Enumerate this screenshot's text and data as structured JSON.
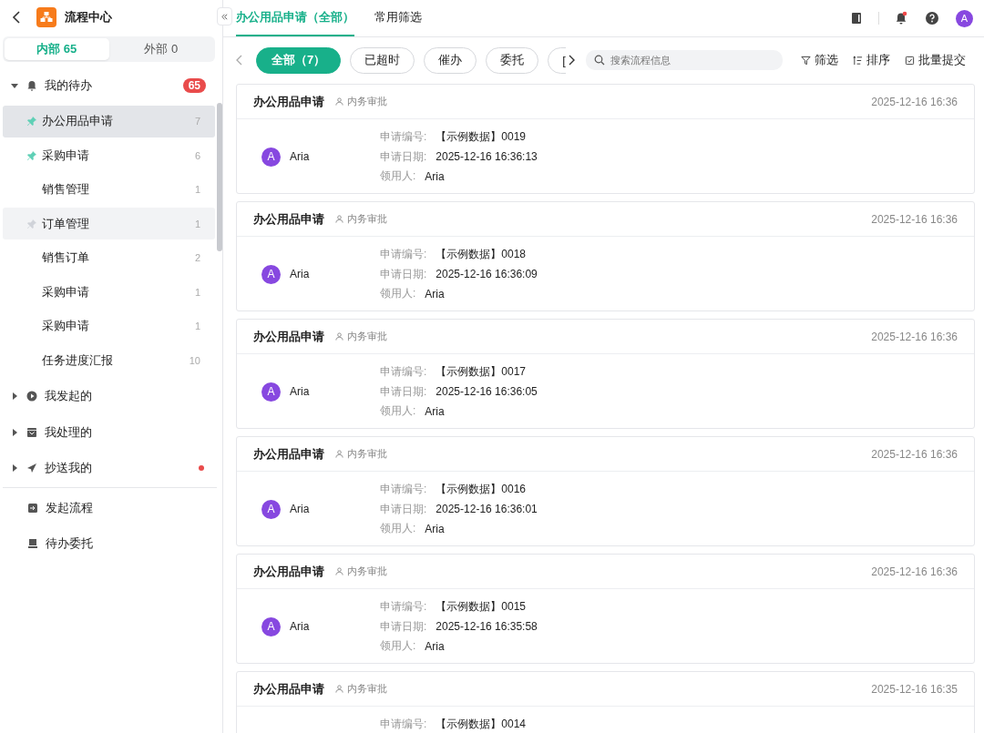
{
  "app": {
    "title": "流程中心"
  },
  "sidebar": {
    "tabs": [
      {
        "label": "内部 65",
        "selected": true
      },
      {
        "label": "外部 0",
        "selected": false
      }
    ],
    "groups": [
      {
        "label": "我的待办",
        "expanded": true,
        "badge": "65",
        "dot": false,
        "children": [
          {
            "label": "办公用品申请",
            "count": "7",
            "pinned": true,
            "selected": true,
            "hovered": false
          },
          {
            "label": "采购申请",
            "count": "6",
            "pinned": true,
            "selected": false,
            "hovered": false
          },
          {
            "label": "销售管理",
            "count": "1",
            "pinned": false,
            "selected": false,
            "hovered": false
          },
          {
            "label": "订单管理",
            "count": "1",
            "pinned": false,
            "selected": false,
            "hovered": true
          },
          {
            "label": "销售订单",
            "count": "2",
            "pinned": false,
            "selected": false,
            "hovered": false
          },
          {
            "label": "采购申请",
            "count": "1",
            "pinned": false,
            "selected": false,
            "hovered": false
          },
          {
            "label": "采购申请",
            "count": "1",
            "pinned": false,
            "selected": false,
            "hovered": false
          },
          {
            "label": "任务进度汇报",
            "count": "10",
            "pinned": false,
            "selected": false,
            "hovered": false
          }
        ]
      },
      {
        "label": "我发起的",
        "expanded": false,
        "dot": false
      },
      {
        "label": "我处理的",
        "expanded": false,
        "dot": false
      },
      {
        "label": "抄送我的",
        "expanded": false,
        "dot": true
      }
    ],
    "links": [
      {
        "label": "发起流程"
      },
      {
        "label": "待办委托"
      }
    ]
  },
  "tabs": [
    {
      "label": "办公用品申请（全部）",
      "selected": true
    },
    {
      "label": "常用筛选",
      "selected": false
    }
  ],
  "header_icons": {
    "notification_dot": true,
    "avatar": "A"
  },
  "chips": [
    {
      "label": "全部（7）",
      "selected": true
    },
    {
      "label": "已超时",
      "selected": false
    },
    {
      "label": "催办",
      "selected": false
    },
    {
      "label": "委托",
      "selected": false
    },
    {
      "label": "[",
      "selected": false
    }
  ],
  "search": {
    "placeholder": "搜索流程信息"
  },
  "actions": [
    {
      "label": "筛选"
    },
    {
      "label": "排序"
    },
    {
      "label": "批量提交"
    }
  ],
  "cards": [
    {
      "title": "办公用品申请",
      "tag": "内务审批",
      "time": "2025-12-16 16:36",
      "avatar": "A",
      "user": "Aria",
      "fields": [
        {
          "label": "申请编号:",
          "value": "【示例数据】0019"
        },
        {
          "label": "申请日期:",
          "value": "2025-12-16 16:36:13"
        },
        {
          "label": "领用人:",
          "value": "Aria"
        }
      ]
    },
    {
      "title": "办公用品申请",
      "tag": "内务审批",
      "time": "2025-12-16 16:36",
      "avatar": "A",
      "user": "Aria",
      "fields": [
        {
          "label": "申请编号:",
          "value": "【示例数据】0018"
        },
        {
          "label": "申请日期:",
          "value": "2025-12-16 16:36:09"
        },
        {
          "label": "领用人:",
          "value": "Aria"
        }
      ]
    },
    {
      "title": "办公用品申请",
      "tag": "内务审批",
      "time": "2025-12-16 16:36",
      "avatar": "A",
      "user": "Aria",
      "fields": [
        {
          "label": "申请编号:",
          "value": "【示例数据】0017"
        },
        {
          "label": "申请日期:",
          "value": "2025-12-16 16:36:05"
        },
        {
          "label": "领用人:",
          "value": "Aria"
        }
      ]
    },
    {
      "title": "办公用品申请",
      "tag": "内务审批",
      "time": "2025-12-16 16:36",
      "avatar": "A",
      "user": "Aria",
      "fields": [
        {
          "label": "申请编号:",
          "value": "【示例数据】0016"
        },
        {
          "label": "申请日期:",
          "value": "2025-12-16 16:36:01"
        },
        {
          "label": "领用人:",
          "value": "Aria"
        }
      ]
    },
    {
      "title": "办公用品申请",
      "tag": "内务审批",
      "time": "2025-12-16 16:36",
      "avatar": "A",
      "user": "Aria",
      "fields": [
        {
          "label": "申请编号:",
          "value": "【示例数据】0015"
        },
        {
          "label": "申请日期:",
          "value": "2025-12-16 16:35:58"
        },
        {
          "label": "领用人:",
          "value": "Aria"
        }
      ]
    },
    {
      "title": "办公用品申请",
      "tag": "内务审批",
      "time": "2025-12-16 16:35",
      "fields": [
        {
          "label": "申请编号:",
          "value": "【示例数据】0014"
        }
      ]
    }
  ]
}
